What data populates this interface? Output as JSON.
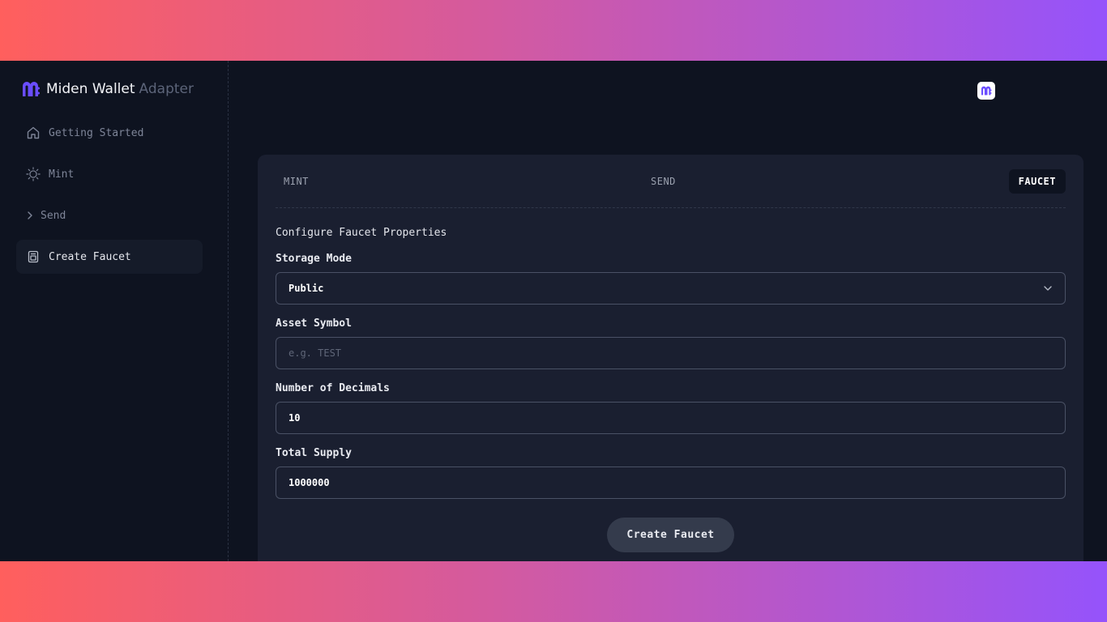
{
  "brand": {
    "name": "Miden Wallet",
    "subtitle": "Adapter",
    "logo_icon": "miden-logo-icon",
    "accent": "#6a4dff"
  },
  "sidebar": {
    "items": [
      {
        "label": "Getting Started",
        "icon": "home-icon",
        "active": false
      },
      {
        "label": "Mint",
        "icon": "sun-icon",
        "active": false
      },
      {
        "label": "Send",
        "icon": "chevron-right-icon",
        "active": false
      },
      {
        "label": "Create Faucet",
        "icon": "faucet-icon",
        "active": true
      }
    ]
  },
  "header": {
    "wallet_icon": "miden-wallet-icon"
  },
  "tabs": [
    {
      "label": "MINT",
      "active": false
    },
    {
      "label": "SEND",
      "active": false
    },
    {
      "label": "FAUCET",
      "active": true
    }
  ],
  "form": {
    "title": "Configure Faucet Properties",
    "storage_mode": {
      "label": "Storage Mode",
      "value": "Public",
      "icon": "chevron-down-icon"
    },
    "asset_symbol": {
      "label": "Asset Symbol",
      "value": "",
      "placeholder": "e.g. TEST"
    },
    "decimals": {
      "label": "Number of Decimals",
      "value": "10"
    },
    "total_supply": {
      "label": "Total Supply",
      "value": "1000000"
    },
    "submit_label": "Create Faucet"
  },
  "colors": {
    "background": "#0e1320",
    "card": "#1a1f30",
    "border": "#4a5165",
    "gradient_start": "#ff5f5d",
    "gradient_end": "#9553fb"
  }
}
